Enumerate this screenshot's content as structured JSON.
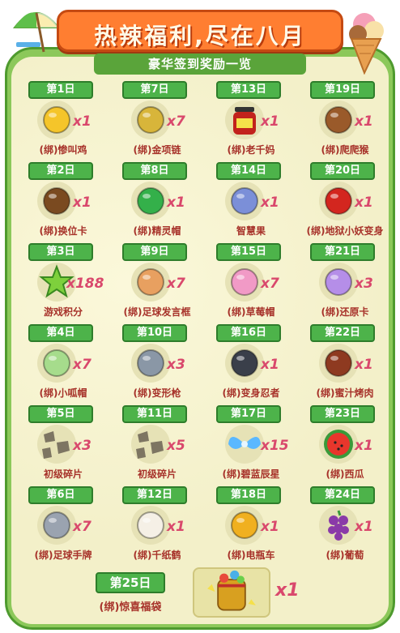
{
  "header": {
    "title": "热辣福利,尽在八月",
    "subtitle": "豪华签到奖励一览"
  },
  "rewards": [
    {
      "day": "第1日",
      "qty": "x1",
      "name": "(绑)惨叫鸡",
      "icon": "rubber-chicken-icon",
      "color": "#f5c52a"
    },
    {
      "day": "第7日",
      "qty": "x7",
      "name": "(绑)金项链",
      "icon": "gold-necklace-icon",
      "color": "#d8b53a"
    },
    {
      "day": "第13日",
      "qty": "x1",
      "name": "(绑)老千妈",
      "icon": "chili-sauce-jar-icon",
      "color": "#c2221c"
    },
    {
      "day": "第19日",
      "qty": "x1",
      "name": "(绑)爬爬猴",
      "icon": "monkey-icon",
      "color": "#9a5a2a"
    },
    {
      "day": "第2日",
      "qty": "x1",
      "name": "(绑)换位卡",
      "icon": "swap-card-icon",
      "color": "#7a4a20"
    },
    {
      "day": "第8日",
      "qty": "x1",
      "name": "(绑)精灵帽",
      "icon": "elf-hat-icon",
      "color": "#34b04a"
    },
    {
      "day": "第14日",
      "qty": "x1",
      "name": "智慧果",
      "icon": "wisdom-fruit-icon",
      "color": "#7b8fd8"
    },
    {
      "day": "第20日",
      "qty": "x1",
      "name": "(绑)地狱小妖变身",
      "icon": "little-devil-icon",
      "color": "#d3261f"
    },
    {
      "day": "第3日",
      "qty": "x188",
      "name": "游戏积分",
      "icon": "green-star-icon",
      "color": "#7ed03c"
    },
    {
      "day": "第9日",
      "qty": "x7",
      "name": "(绑)足球发言框",
      "icon": "chat-frame-icon",
      "color": "#e8a060"
    },
    {
      "day": "第15日",
      "qty": "x7",
      "name": "(绑)草莓帽",
      "icon": "strawberry-hat-icon",
      "color": "#f19ac6"
    },
    {
      "day": "第21日",
      "qty": "x3",
      "name": "(绑)还原卡",
      "icon": "restore-card-icon",
      "color": "#b58ee8"
    },
    {
      "day": "第4日",
      "qty": "x7",
      "name": "(绑)小呱帽",
      "icon": "frog-hat-icon",
      "color": "#a6dc8c"
    },
    {
      "day": "第10日",
      "qty": "x3",
      "name": "(绑)变形枪",
      "icon": "transform-gun-icon",
      "color": "#8a97a6"
    },
    {
      "day": "第16日",
      "qty": "x1",
      "name": "(绑)变身忍者",
      "icon": "ninja-icon",
      "color": "#3a3f4a"
    },
    {
      "day": "第22日",
      "qty": "x1",
      "name": "(绑)蜜汁烤肉",
      "icon": "bbq-meat-icon",
      "color": "#8e3a20"
    },
    {
      "day": "第5日",
      "qty": "x3",
      "name": "初级碎片",
      "icon": "stone-shards-icon",
      "color": "#7d7562"
    },
    {
      "day": "第11日",
      "qty": "x5",
      "name": "初级碎片",
      "icon": "stone-shards-icon",
      "color": "#7d7562"
    },
    {
      "day": "第17日",
      "qty": "x15",
      "name": "(绑)碧蓝辰星",
      "icon": "blue-wings-icon",
      "color": "#5ab8ff"
    },
    {
      "day": "第23日",
      "qty": "x1",
      "name": "(绑)西瓜",
      "icon": "watermelon-icon",
      "color": "#e8362c"
    },
    {
      "day": "第6日",
      "qty": "x7",
      "name": "(绑)足球手牌",
      "icon": "hand-mirror-icon",
      "color": "#9aa3b0"
    },
    {
      "day": "第12日",
      "qty": "x1",
      "name": "(绑)千纸鹤",
      "icon": "paper-crane-icon",
      "color": "#f5f0e6"
    },
    {
      "day": "第18日",
      "qty": "x1",
      "name": "(绑)电瓶车",
      "icon": "scooter-icon",
      "color": "#f0b020"
    },
    {
      "day": "第24日",
      "qty": "x1",
      "name": "(绑)葡萄",
      "icon": "grapes-icon",
      "color": "#8a3aa8"
    }
  ],
  "final_reward": {
    "day": "第25日",
    "qty": "x1",
    "name": "(绑)惊喜福袋",
    "icon": "surprise-bag-icon",
    "color": "#f0c020"
  }
}
